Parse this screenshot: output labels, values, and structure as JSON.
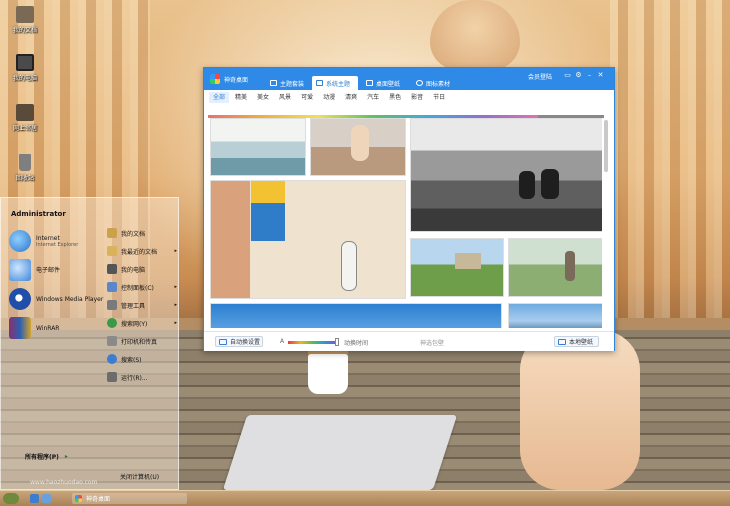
{
  "desktop": {
    "icons": [
      {
        "label": "我的文档",
        "icon": "folder-documents-icon",
        "color": "#7a6a55"
      },
      {
        "label": "我的电脑",
        "icon": "computer-icon",
        "color": "#4a4a4a"
      },
      {
        "label": "网上邻居",
        "icon": "network-icon",
        "color": "#5a4a3a"
      },
      {
        "label": "回收站",
        "icon": "recycle-bin-icon",
        "color": "#7f7f7f"
      }
    ]
  },
  "start_menu": {
    "user": "Administrator",
    "pinned": [
      {
        "title": "Internet",
        "subtitle": "Internet Explorer",
        "icon": "internet-explorer-icon",
        "color": "#2a73c9"
      },
      {
        "title": "电子邮件",
        "subtitle": "",
        "icon": "email-icon",
        "color": "#3d86d8"
      },
      {
        "title": "Windows Media Player",
        "subtitle": "",
        "icon": "media-player-icon",
        "color": "#1f4fa8"
      },
      {
        "title": "WinRAR",
        "subtitle": "",
        "icon": "winrar-icon",
        "color": "#8a2f6e"
      }
    ],
    "places": [
      {
        "label": "我的文档",
        "arrow": "",
        "icon": "documents-icon"
      },
      {
        "label": "我最近的文档",
        "arrow": "▸",
        "icon": "recent-documents-icon"
      },
      {
        "label": "我的电脑",
        "arrow": "",
        "icon": "computer-icon"
      },
      {
        "label": "控制面板(C)",
        "arrow": "▸",
        "icon": "control-panel-icon"
      },
      {
        "label": "管理工具",
        "arrow": "▸",
        "icon": "admin-tools-icon"
      },
      {
        "label": "搜索网(Y)",
        "arrow": "▸",
        "icon": "search-web-icon"
      },
      {
        "label": "打印机和传真",
        "arrow": "",
        "icon": "printer-icon"
      },
      {
        "label": "搜索(S)",
        "arrow": "",
        "icon": "search-icon"
      },
      {
        "label": "运行(R)...",
        "arrow": "",
        "icon": "run-icon"
      }
    ],
    "all_programs": "所有程序(P)",
    "all_programs_arrow": "▸",
    "shutdown": "关闭计算机(U)"
  },
  "taskbar": {
    "task_label": "神奇桌面",
    "watermark": "www.haozhuodao.com"
  },
  "app": {
    "title": "神奇桌面",
    "tabs": [
      {
        "label": "主题套装",
        "active": false
      },
      {
        "label": "系统主题",
        "active": true
      },
      {
        "label": "桌面壁纸",
        "active": false
      },
      {
        "label": "图标素材",
        "active": false
      }
    ],
    "vip_label": "会员登陆",
    "categories": [
      "全部",
      "精美",
      "美女",
      "风景",
      "可爱",
      "动漫",
      "清爽",
      "汽车",
      "黑色",
      "影音",
      "节日"
    ],
    "active_category": "全部",
    "auto_switch_label": "自动换设置",
    "speed_label": "动换时间",
    "slider_value": 0.95,
    "min_label": "A",
    "center_label": "神选包壁",
    "local_wallpaper_label": "本地壁纸",
    "accent": "#2e8ae6"
  }
}
